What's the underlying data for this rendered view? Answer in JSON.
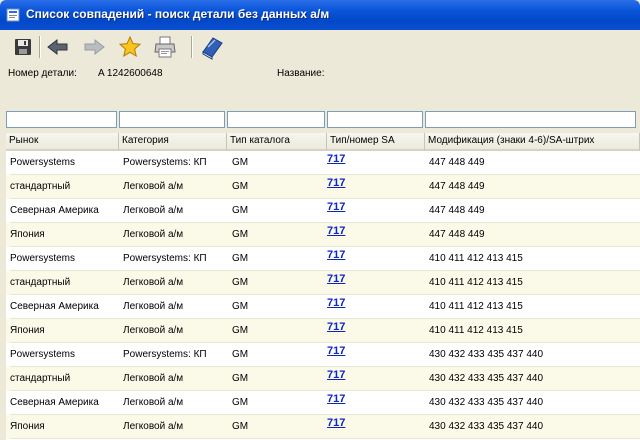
{
  "window": {
    "title": "Список совпадений - поиск детали без данных а/м"
  },
  "toolbar": {
    "icons": [
      "save-icon",
      "back-icon",
      "forward-icon",
      "favorite-star-icon",
      "print-icon",
      "help-book-icon"
    ]
  },
  "info": {
    "part_label": "Номер детали:",
    "part_value": "A  1242600648",
    "name_label": "Название:",
    "name_value": ""
  },
  "filters": [
    "",
    "",
    "",
    "",
    ""
  ],
  "columns": [
    "Рынок",
    "Категория",
    "Тип каталога",
    "Тип/номер SA",
    "Модификация (знаки 4-6)/SA-штрих"
  ],
  "rows": [
    {
      "market": "Powersystems",
      "category": "Powersystems: КП",
      "catalog": "GM",
      "sa": "717",
      "mod": "447 448 449"
    },
    {
      "market": "стандартный",
      "category": "Легковой а/м",
      "catalog": "GM",
      "sa": "717",
      "mod": "447 448 449"
    },
    {
      "market": "Северная Америка",
      "category": "Легковой а/м",
      "catalog": "GM",
      "sa": "717",
      "mod": "447 448 449"
    },
    {
      "market": "Япония",
      "category": "Легковой а/м",
      "catalog": "GM",
      "sa": "717",
      "mod": "447 448 449"
    },
    {
      "market": "Powersystems",
      "category": "Powersystems: КП",
      "catalog": "GM",
      "sa": "717",
      "mod": "410 411 412 413 415"
    },
    {
      "market": "стандартный",
      "category": "Легковой а/м",
      "catalog": "GM",
      "sa": "717",
      "mod": "410 411 412 413 415"
    },
    {
      "market": "Северная Америка",
      "category": "Легковой а/м",
      "catalog": "GM",
      "sa": "717",
      "mod": "410 411 412 413 415"
    },
    {
      "market": "Япония",
      "category": "Легковой а/м",
      "catalog": "GM",
      "sa": "717",
      "mod": "410 411 412 413 415"
    },
    {
      "market": "Powersystems",
      "category": "Powersystems: КП",
      "catalog": "GM",
      "sa": "717",
      "mod": "430 432 433 435 437 440"
    },
    {
      "market": "стандартный",
      "category": "Легковой а/м",
      "catalog": "GM",
      "sa": "717",
      "mod": "430 432 433 435 437 440"
    },
    {
      "market": "Северная Америка",
      "category": "Легковой а/м",
      "catalog": "GM",
      "sa": "717",
      "mod": "430 432 433 435 437 440"
    },
    {
      "market": "Япония",
      "category": "Легковой а/м",
      "catalog": "GM",
      "sa": "717",
      "mod": "430 432 433 435 437 440"
    }
  ],
  "colors": {
    "title_bar": "#0a55d9",
    "link": "#0b24c8",
    "alt_row": "#fbf9e8",
    "face": "#ece9d8"
  }
}
